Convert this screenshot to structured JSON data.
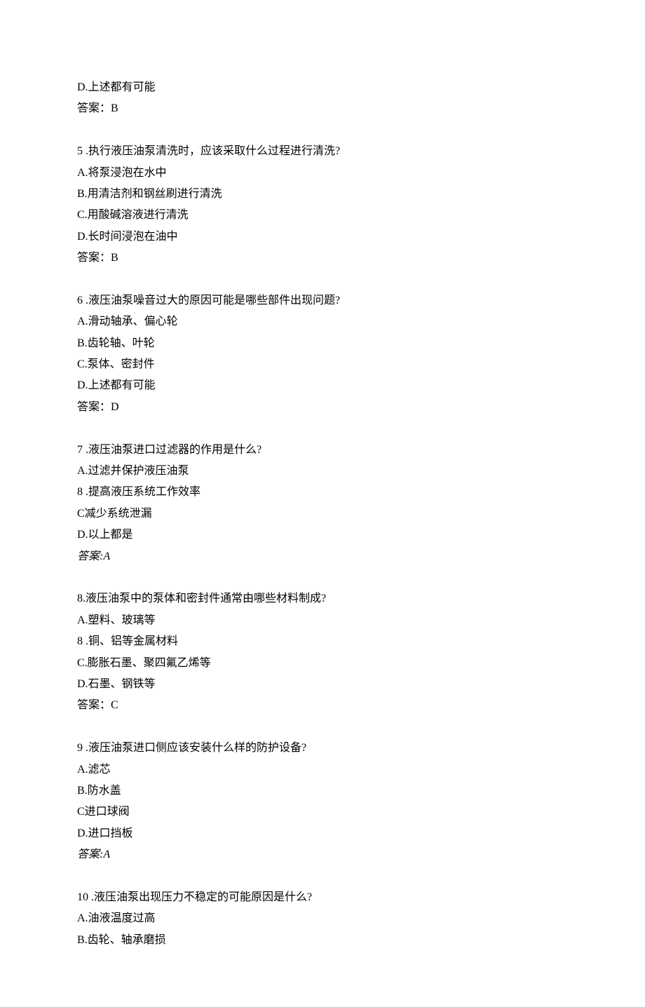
{
  "top": {
    "optionD": "D.上述都有可能",
    "answer": "答案：B"
  },
  "q5": {
    "question": "5 .执行液压油泵清洗时，应该采取什么过程进行清洗?",
    "A": "A.将泵浸泡在水中",
    "B": "B.用清洁剂和钢丝刷进行清洗",
    "C": "C.用酸碱溶液进行清洗",
    "D": "D.长时间浸泡在油中",
    "answer": "答案：B"
  },
  "q6": {
    "question": "6 .液压油泵噪音过大的原因可能是哪些部件出现问题?",
    "A": "A.滑动轴承、偏心轮",
    "B": "B.齿轮轴、叶轮",
    "C": "C.泵体、密封件",
    "D": "D.上述都有可能",
    "answer": "答案：D"
  },
  "q7": {
    "question": "7 .液压油泵进口过滤器的作用是什么?",
    "A": "A.过滤并保护液压油泵",
    "B": "8 .提高液压系统工作效率",
    "C": "C减少系统泄漏",
    "D": "D.以上都是",
    "answer": "答案:A"
  },
  "q8": {
    "question": "8.液压油泵中的泵体和密封件通常由哪些材料制成?",
    "A": "A.塑料、玻璃等",
    "B": "8 .铜、铝等金属材料",
    "C": "C.膨胀石墨、聚四氟乙烯等",
    "D": "D.石墨、钢铁等",
    "answer": "答案：C"
  },
  "q9": {
    "question": "9 .液压油泵进口侧应该安装什么样的防护设备?",
    "A": "A.滤芯",
    "B": "B.防水盖",
    "C": "C进口球阀",
    "D": "D.进口挡板",
    "answer": "答案:A"
  },
  "q10": {
    "question": "10 .液压油泵出现压力不稳定的可能原因是什么?",
    "A": "A.油液温度过高",
    "B": "B.齿轮、轴承磨损"
  }
}
